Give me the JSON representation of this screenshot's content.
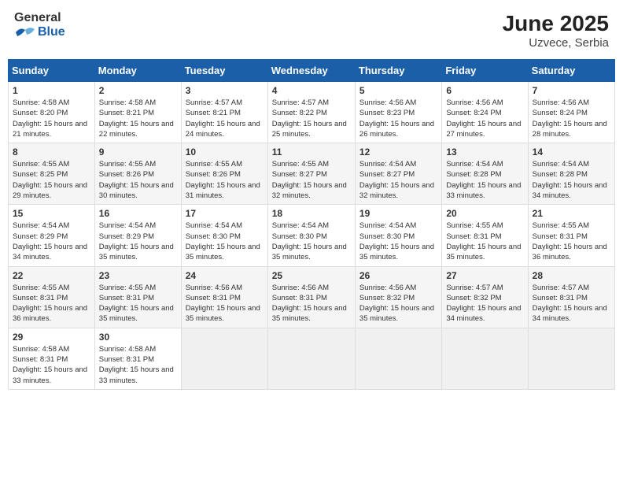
{
  "header": {
    "logo_text_general": "General",
    "logo_text_blue": "Blue",
    "title": "June 2025",
    "subtitle": "Uzvece, Serbia"
  },
  "calendar": {
    "days_of_week": [
      "Sunday",
      "Monday",
      "Tuesday",
      "Wednesday",
      "Thursday",
      "Friday",
      "Saturday"
    ],
    "weeks": [
      [
        null,
        {
          "day": 2,
          "sunrise": "4:58 AM",
          "sunset": "8:21 PM",
          "daylight": "15 hours and 22 minutes."
        },
        {
          "day": 3,
          "sunrise": "4:57 AM",
          "sunset": "8:21 PM",
          "daylight": "15 hours and 24 minutes."
        },
        {
          "day": 4,
          "sunrise": "4:57 AM",
          "sunset": "8:22 PM",
          "daylight": "15 hours and 25 minutes."
        },
        {
          "day": 5,
          "sunrise": "4:56 AM",
          "sunset": "8:23 PM",
          "daylight": "15 hours and 26 minutes."
        },
        {
          "day": 6,
          "sunrise": "4:56 AM",
          "sunset": "8:24 PM",
          "daylight": "15 hours and 27 minutes."
        },
        {
          "day": 7,
          "sunrise": "4:56 AM",
          "sunset": "8:24 PM",
          "daylight": "15 hours and 28 minutes."
        }
      ],
      [
        {
          "day": 8,
          "sunrise": "4:55 AM",
          "sunset": "8:25 PM",
          "daylight": "15 hours and 29 minutes."
        },
        {
          "day": 9,
          "sunrise": "4:55 AM",
          "sunset": "8:26 PM",
          "daylight": "15 hours and 30 minutes."
        },
        {
          "day": 10,
          "sunrise": "4:55 AM",
          "sunset": "8:26 PM",
          "daylight": "15 hours and 31 minutes."
        },
        {
          "day": 11,
          "sunrise": "4:55 AM",
          "sunset": "8:27 PM",
          "daylight": "15 hours and 32 minutes."
        },
        {
          "day": 12,
          "sunrise": "4:54 AM",
          "sunset": "8:27 PM",
          "daylight": "15 hours and 32 minutes."
        },
        {
          "day": 13,
          "sunrise": "4:54 AM",
          "sunset": "8:28 PM",
          "daylight": "15 hours and 33 minutes."
        },
        {
          "day": 14,
          "sunrise": "4:54 AM",
          "sunset": "8:28 PM",
          "daylight": "15 hours and 34 minutes."
        }
      ],
      [
        {
          "day": 15,
          "sunrise": "4:54 AM",
          "sunset": "8:29 PM",
          "daylight": "15 hours and 34 minutes."
        },
        {
          "day": 16,
          "sunrise": "4:54 AM",
          "sunset": "8:29 PM",
          "daylight": "15 hours and 35 minutes."
        },
        {
          "day": 17,
          "sunrise": "4:54 AM",
          "sunset": "8:30 PM",
          "daylight": "15 hours and 35 minutes."
        },
        {
          "day": 18,
          "sunrise": "4:54 AM",
          "sunset": "8:30 PM",
          "daylight": "15 hours and 35 minutes."
        },
        {
          "day": 19,
          "sunrise": "4:54 AM",
          "sunset": "8:30 PM",
          "daylight": "15 hours and 35 minutes."
        },
        {
          "day": 20,
          "sunrise": "4:55 AM",
          "sunset": "8:31 PM",
          "daylight": "15 hours and 35 minutes."
        },
        {
          "day": 21,
          "sunrise": "4:55 AM",
          "sunset": "8:31 PM",
          "daylight": "15 hours and 36 minutes."
        }
      ],
      [
        {
          "day": 22,
          "sunrise": "4:55 AM",
          "sunset": "8:31 PM",
          "daylight": "15 hours and 36 minutes."
        },
        {
          "day": 23,
          "sunrise": "4:55 AM",
          "sunset": "8:31 PM",
          "daylight": "15 hours and 35 minutes."
        },
        {
          "day": 24,
          "sunrise": "4:56 AM",
          "sunset": "8:31 PM",
          "daylight": "15 hours and 35 minutes."
        },
        {
          "day": 25,
          "sunrise": "4:56 AM",
          "sunset": "8:31 PM",
          "daylight": "15 hours and 35 minutes."
        },
        {
          "day": 26,
          "sunrise": "4:56 AM",
          "sunset": "8:32 PM",
          "daylight": "15 hours and 35 minutes."
        },
        {
          "day": 27,
          "sunrise": "4:57 AM",
          "sunset": "8:32 PM",
          "daylight": "15 hours and 34 minutes."
        },
        {
          "day": 28,
          "sunrise": "4:57 AM",
          "sunset": "8:31 PM",
          "daylight": "15 hours and 34 minutes."
        }
      ],
      [
        {
          "day": 29,
          "sunrise": "4:58 AM",
          "sunset": "8:31 PM",
          "daylight": "15 hours and 33 minutes."
        },
        {
          "day": 30,
          "sunrise": "4:58 AM",
          "sunset": "8:31 PM",
          "daylight": "15 hours and 33 minutes."
        },
        null,
        null,
        null,
        null,
        null
      ]
    ],
    "week1_day1": {
      "day": 1,
      "sunrise": "4:58 AM",
      "sunset": "8:20 PM",
      "daylight": "15 hours and 21 minutes."
    }
  }
}
